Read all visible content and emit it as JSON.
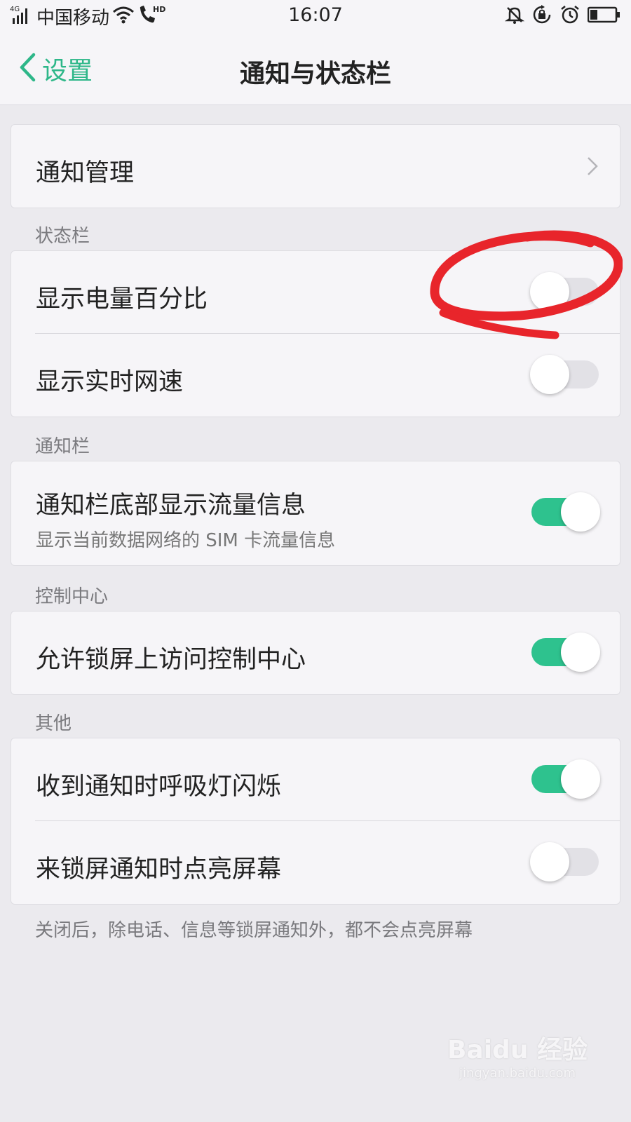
{
  "status_bar": {
    "network": "4G",
    "carrier": "中国移动",
    "hd_badge": "HD",
    "time": "16:07",
    "icons": [
      "signal-icon",
      "wifi-icon",
      "volte-call-icon",
      "mute-bell-icon",
      "rotation-lock-icon",
      "alarm-icon",
      "battery-icon"
    ],
    "battery_level": 0.3
  },
  "header": {
    "back_label": "设置",
    "title": "通知与状态栏"
  },
  "groups": {
    "notification_management": {
      "label": "通知管理"
    },
    "status_bar": {
      "heading": "状态栏",
      "items": [
        {
          "label": "显示电量百分比",
          "on": false
        },
        {
          "label": "显示实时网速",
          "on": false
        }
      ]
    },
    "notification_bar": {
      "heading": "通知栏",
      "items": [
        {
          "label": "通知栏底部显示流量信息",
          "sub": "显示当前数据网络的 SIM 卡流量信息",
          "on": true
        }
      ]
    },
    "control_center": {
      "heading": "控制中心",
      "items": [
        {
          "label": "允许锁屏上访问控制中心",
          "on": true
        }
      ]
    },
    "other": {
      "heading": "其他",
      "items": [
        {
          "label": "收到通知时呼吸灯闪烁",
          "on": true
        },
        {
          "label": "来锁屏通知时点亮屏幕",
          "on": false
        }
      ],
      "footer": "关闭后，除电话、信息等锁屏通知外，都不会点亮屏幕"
    }
  },
  "watermark": {
    "main": "Baidu 经验",
    "sub": "jingyan.baidu.com"
  },
  "colors": {
    "accent": "#2eb789",
    "toggle_on": "#2ec28e",
    "annotation": "#e8252b"
  }
}
